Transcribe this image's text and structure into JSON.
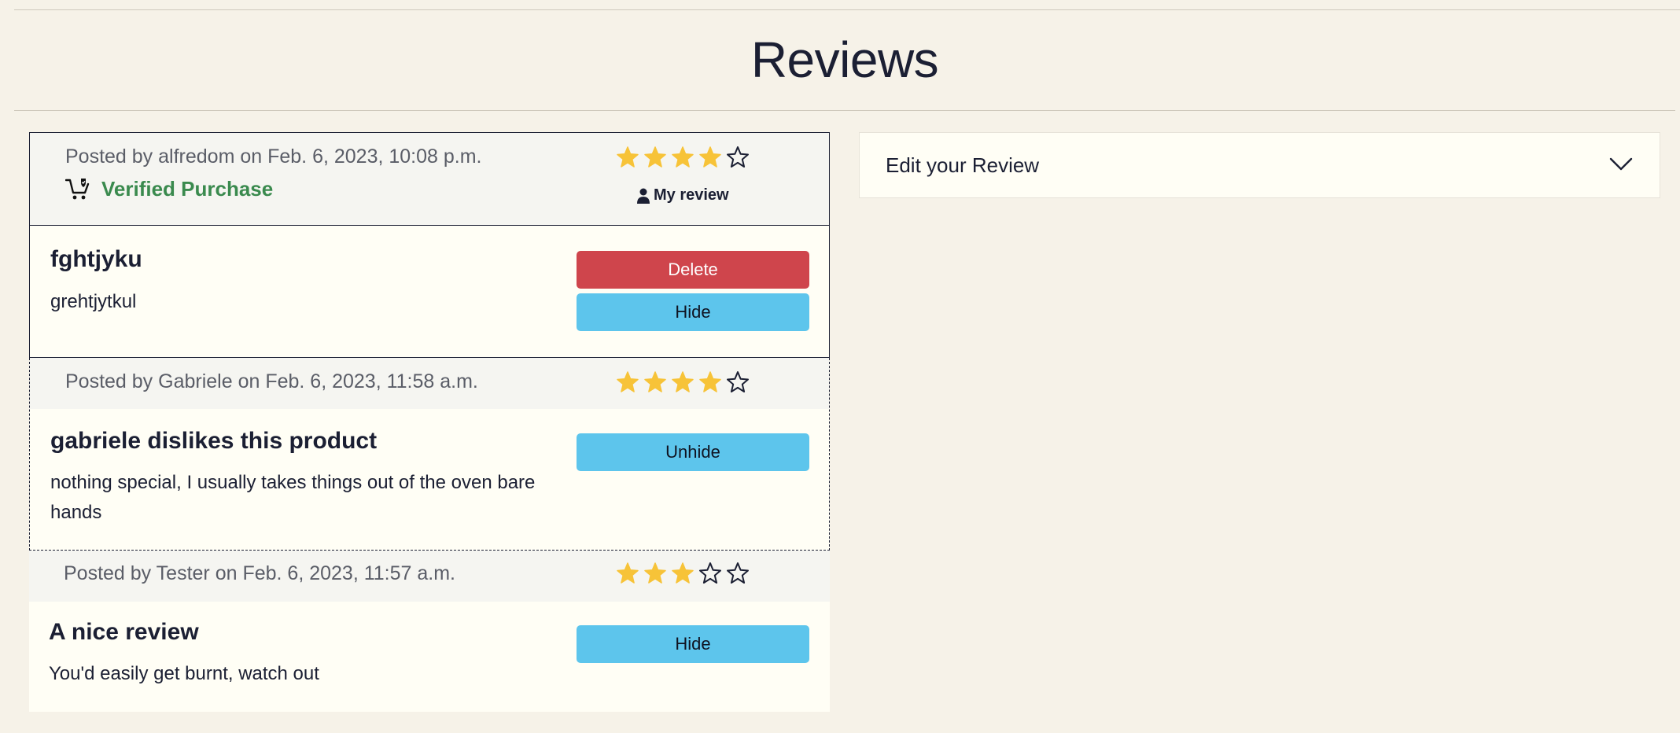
{
  "page": {
    "title": "Reviews"
  },
  "colors": {
    "star_filled": "#f7c338",
    "verified": "#3a8a4e",
    "delete": "#cf454c",
    "hide": "#5dc5ec"
  },
  "reviews": [
    {
      "posted_by": "Posted by alfredom on Feb. 6, 2023, 10:08 p.m.",
      "rating": 4,
      "max_rating": 5,
      "verified_icon": "cart-check-icon",
      "verified_label": "Verified Purchase",
      "my_review_icon": "user-icon",
      "my_review_label": "My review",
      "title": "fghtjyku",
      "text": "grehtjytkul",
      "delete_label": "Delete",
      "hide_label": "Hide"
    },
    {
      "posted_by": "Posted by Gabriele on Feb. 6, 2023, 11:58 a.m.",
      "rating": 4,
      "max_rating": 5,
      "title": "gabriele dislikes this product",
      "text": "nothing special, I usually takes things out of the oven bare hands",
      "unhide_label": "Unhide"
    },
    {
      "posted_by": "Posted by Tester on Feb. 6, 2023, 11:57 a.m.",
      "rating": 3,
      "max_rating": 5,
      "title": "A nice review",
      "text": "You'd easily get burnt, watch out",
      "hide_label": "Hide"
    }
  ],
  "edit_panel": {
    "label": "Edit your Review",
    "icon": "chevron-down-icon"
  }
}
